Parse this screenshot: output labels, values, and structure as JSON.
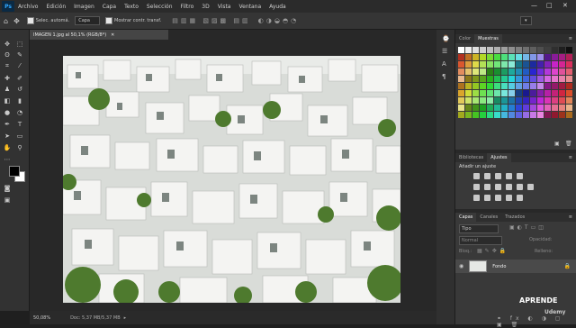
{
  "menubar": {
    "logo": "Ps",
    "items": [
      "Archivo",
      "Edición",
      "Imagen",
      "Capa",
      "Texto",
      "Selección",
      "Filtro",
      "3D",
      "Vista",
      "Ventana",
      "Ayuda"
    ],
    "minimize": "—",
    "maximize": "□",
    "close": "✕"
  },
  "options": {
    "auto_select": "Selec. automá.",
    "layer_select": "Capa",
    "transform": "Mostrar contr. transf."
  },
  "document": {
    "tab_title": "IMAGEN 1.jpg al 50,1% (RGB/8*)",
    "zoom": "50,08%",
    "doc_info": "Doc: 5,37 MB/5,37 MB"
  },
  "swatches_panel": {
    "tabs": [
      "Color",
      "Muestras"
    ],
    "active_tab": "Muestras"
  },
  "adjust_panel": {
    "tabs": [
      "Bibliotecas",
      "Ajustes"
    ],
    "active_tab": "Ajustes",
    "heading": "Añadir un ajuste"
  },
  "layers_panel": {
    "tabs": [
      "Capas",
      "Canales",
      "Trazados"
    ],
    "active_tab": "Capas",
    "kind_label": "Tipo",
    "blend_mode": "Normal",
    "opacity_label": "Opacidad:",
    "lock_label": "Bloq.:",
    "fill_label": "Relleno:",
    "layer_name": "Fondo"
  },
  "watermark": {
    "line1": "APRENDE",
    "line2": "Udemy"
  },
  "colors": {
    "accent": "#31a8ff",
    "panel_bg": "#393939",
    "app_bg": "#282828"
  }
}
